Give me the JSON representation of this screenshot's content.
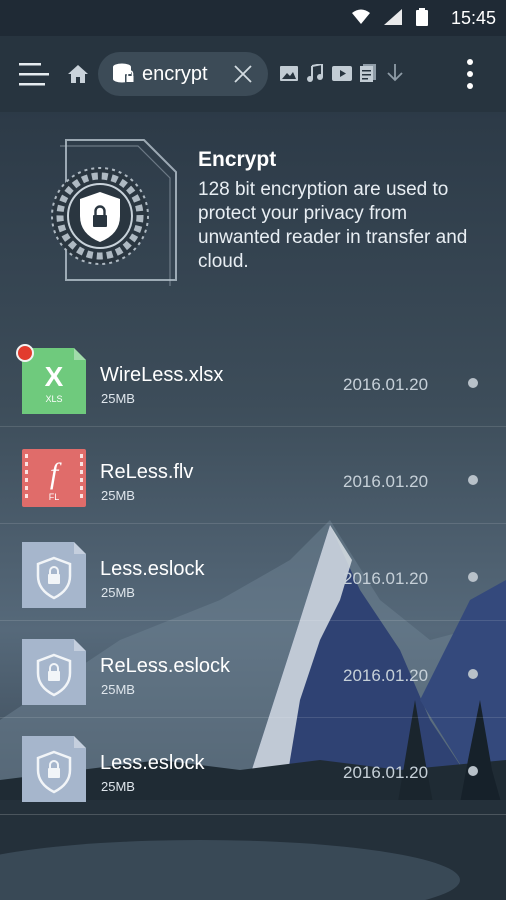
{
  "status_bar": {
    "time": "15:45",
    "icons": [
      "wifi-icon",
      "signal-icon",
      "battery-icon"
    ]
  },
  "toolbar": {
    "chip_label": "encrypt",
    "icons": [
      "menu-icon",
      "home-icon",
      "lock-drive-icon",
      "close-icon",
      "image-icon",
      "music-icon",
      "video-icon",
      "document-icon",
      "download-icon",
      "more-icon"
    ]
  },
  "encrypt_card": {
    "title": "Encrypt",
    "description": "128 bit encryption are used to protect your privacy from unwanted reader in transfer and cloud."
  },
  "files": [
    {
      "name": "WireLess.xlsx",
      "size": "25MB",
      "date": "2016.01.20",
      "type": "xls",
      "type_label": "XLS",
      "glyph": "X",
      "unread": true
    },
    {
      "name": "ReLess.flv",
      "size": "25MB",
      "date": "2016.01.20",
      "type": "flv",
      "type_label": "FL",
      "glyph": "f",
      "unread": false
    },
    {
      "name": "Less.eslock",
      "size": "25MB",
      "date": "2016.01.20",
      "type": "eslock",
      "unread": false
    },
    {
      "name": "ReLess.eslock",
      "size": "25MB",
      "date": "2016.01.20",
      "type": "eslock",
      "unread": false
    },
    {
      "name": "Less.eslock",
      "size": "25MB",
      "date": "2016.01.20",
      "type": "eslock",
      "unread": false
    }
  ],
  "colors": {
    "xls": "#6fca7d",
    "flv": "#e06c6a",
    "eslock": "#a6b6cc",
    "unread_dot": "#e23b2d",
    "toolbar": "#27343f",
    "status_bar": "#1f2a35"
  }
}
